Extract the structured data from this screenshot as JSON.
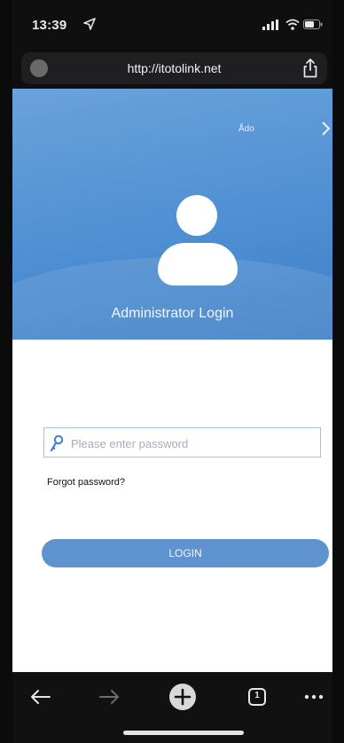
{
  "status_bar": {
    "time": "13:39",
    "icons": [
      "location-arrow-icon",
      "signal-icon",
      "wifi-icon",
      "battery-icon"
    ]
  },
  "browser": {
    "url": "http://itotolink.net",
    "site_icon": "site-info-icon",
    "share_icon": "share-icon"
  },
  "login": {
    "lang_link": "Ådo",
    "next_icon": "chevron-right-icon",
    "title": "Administrator Login",
    "password_placeholder": "Please enter password",
    "password_value": "",
    "forgot_label": "Forgot password?",
    "login_label": "LOGIN",
    "accent_color": "#5e93cf",
    "hero_color": "#4f8fd3"
  },
  "toolbar": {
    "tab_count": "1",
    "icons": [
      "back-arrow-icon",
      "forward-arrow-icon",
      "new-tab-plus-icon",
      "tabs-icon",
      "more-icon"
    ]
  }
}
